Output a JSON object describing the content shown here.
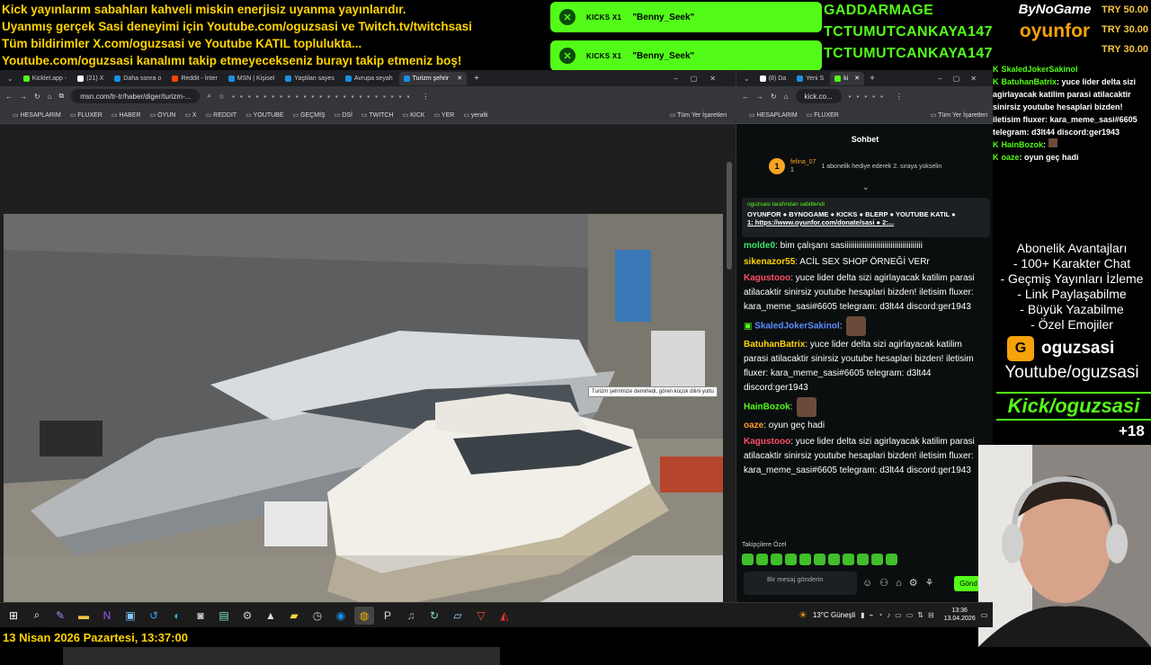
{
  "banner": {
    "lines": [
      "Kick yayınlarım sabahları kahveli miskin enerjisiz uyanma yayınlarıdır.",
      "Uyanmış gerçek Sasi deneyimi için Youtube.com/oguzsasi ve Twitch.tv/twitchsasi",
      "Tüm bildirimler X.com/oguzsasi ve Youtube KATIL toplulukta...",
      "Youtube.com/oguzsasi kanalımı takip etmeyecekseniz burayı takip etmeniz boş!"
    ]
  },
  "kicks_alerts": [
    {
      "label": "KICKS X1",
      "user": "\"Benny_Seek\""
    },
    {
      "label": "KICKS X1",
      "user": "\"Benny_Seek\""
    }
  ],
  "gifters": [
    "GADDARMAGE",
    "TCTUMUTCANKAYA147",
    "TCTUMUTCANKAYA147"
  ],
  "brand": {
    "top": "ByNoGame",
    "bottom": "oyunfor"
  },
  "tries": [
    "TRY 50.00",
    "TRY 30.00",
    "TRY 30.00"
  ],
  "browser1": {
    "tabs": [
      "Kicklet.app -",
      "(21) X",
      "Daha sonra o",
      "Reddit - İnter",
      "MSN | Kişisel",
      "Yaştilan sayes",
      "Avrupa seyah",
      "Turizm şehrir"
    ],
    "url": "msn.com/tr-tr/haber/diger/turizm-...",
    "bookmarks": [
      "HESAPLARIM",
      "FLUXER",
      "HABER",
      "OYUN",
      "X",
      "REDDIT",
      "YOUTUBE",
      "GEÇMİŞ",
      "DSİ",
      "TWITCH",
      "KICK",
      "YER",
      "yeralti"
    ],
    "all_bookmarks": "Tüm Yer İşaretleri",
    "tooltip": "Turizm şehrimize demirledi, gören küçük dilini yuttu"
  },
  "browser2": {
    "tabs": [
      "(8) Da",
      "Yeni S",
      "ki"
    ],
    "url": "kick.co...",
    "bookmarks": [
      "HESAPLARIM",
      "FLUXER"
    ],
    "all_bookmarks": "Tüm Yer İşaretleri",
    "chat_title": "Sohbet",
    "gift": {
      "rank": "1",
      "user": "felina_07",
      "count": "1",
      "text": "1 abonelik hediye ederek 2. sıraya yükselin"
    },
    "pinned": {
      "by": "oguzsasi tarafından sabitlendi",
      "text": "OYUNFOR ● BYNOGAME ● KICKS ● BLERP ● YOUTUBE KATIL ●",
      "link": "1: https://www.oyunfor.com/donate/sasi ● 2:..."
    },
    "messages": [
      {
        "user": "molde0",
        "color": "#3fe06a",
        "text": "bim çalışanı sasiiiiiiiiiiiiiiiiiiiiiiiiiiiiiiiiiiiiiii"
      },
      {
        "user": "sikenazor55",
        "color": "#ffd400",
        "text": "ACİL SEX SHOP ÖRNEĞİ VERr"
      },
      {
        "user": "Kagustooo",
        "color": "#ff4d6a",
        "text": "yuce lider delta sizi agirlayacak katilim parasi atilacaktir sinirsiz youtube hesaplari bizden! iletisim fluxer: kara_meme_sasi#6605 telegram: d3lt44 discord:ger1943"
      },
      {
        "user": "SkaledJokerSakinol",
        "color": "#5b8cff",
        "text": ""
      },
      {
        "user": "BatuhanBatrix",
        "color": "#ffd400",
        "text": "yuce lider delta sizi agirlayacak katilim parasi atilacaktir sinirsiz youtube hesaplari bizden! iletisim fluxer: kara_meme_sasi#6605 telegram: d3lt44 discord:ger1943"
      },
      {
        "user": "HainBozok",
        "color": "#53fc18",
        "text": ""
      },
      {
        "user": "oaze",
        "color": "#ff9a2a",
        "text": "oyun geç hadi"
      },
      {
        "user": "Kagustooo",
        "color": "#ff4d6a",
        "text": "yuce lider delta sizi agirlayacak katilim parasi atilacaktir sinirsiz youtube hesaplari bizden! iletisim fluxer: kara_meme_sasi#6605 telegram: d3lt44 discord:ger1943"
      }
    ],
    "followers": "Takipçilere Özel",
    "input_placeholder": "Bir mesaj gönderin",
    "send": "Gönd"
  },
  "overlay": {
    "chat": [
      {
        "user": "SkaledJokerSakinol",
        "text": ""
      },
      {
        "user": "BatuhanBatrix",
        "text": "yuce lider delta sizi agirlayacak katilim parasi atilacaktir sinirsiz youtube hesaplari bizden! iletisim fluxer: kara_meme_sasi#6605 telegram: d3lt44 discord:ger1943"
      },
      {
        "user": "HainBozok",
        "text": ""
      },
      {
        "user": "oaze",
        "text": "oyun geç hadi"
      }
    ],
    "perks": [
      "Abonelik Avantajları",
      "- 100+ Karakter Chat",
      "- Geçmiş Yayınları İzleme",
      "- Link Paylaşabilme",
      "- Büyük Yazabilme",
      "- Özel Emojiler"
    ],
    "channel": "oguzsasi",
    "youtube": "Youtube/oguzsasi",
    "kick": "Kick/oguzsasi",
    "plus": "+18"
  },
  "taskbar": {
    "weather": "13°C  Güneşli",
    "time": "13:36",
    "date": "13.04.2026"
  },
  "date_line": "13 Nisan 2026 Pazartesi, 13:37:00"
}
